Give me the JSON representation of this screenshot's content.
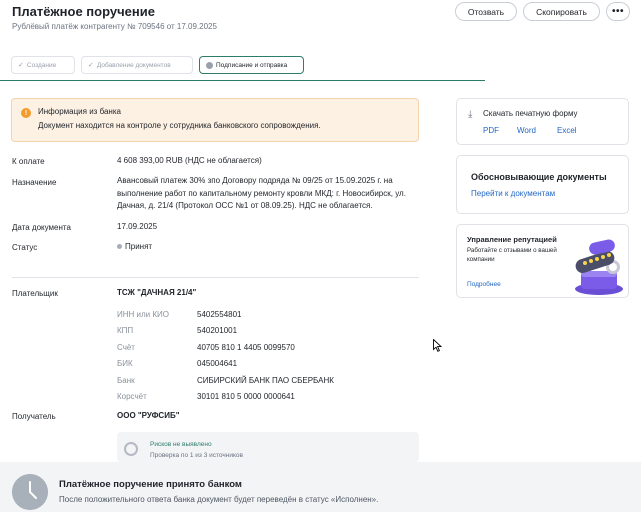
{
  "header": {
    "title": "Платёжное поручение",
    "subtitle": "Рублёвый платёж контрагенту № 709546 от 17.09.2025"
  },
  "actions": {
    "revoke_label": "Отозвать",
    "copy_label": "Скопировать",
    "more_label": "•••"
  },
  "steps": [
    {
      "label": "Создание",
      "state": "done"
    },
    {
      "label": "Добавление документов",
      "state": "done"
    },
    {
      "label": "Подписание и отправка",
      "state": "active"
    }
  ],
  "alert": {
    "title": "Информация из банка",
    "text": "Документ находится на контроле у сотрудника банковского сопровождения.",
    "icon": "warning-icon",
    "color": "#f59b2c"
  },
  "details": {
    "amount_label": "К оплате",
    "amount_value": "4 608 393,00 RUB (НДС не облагается)",
    "purpose_label": "Назначение",
    "purpose_value": "Авансовый платеж 30% зпо Договору подряда № 09/25 от 15.09.2025 г. на выполнение работ по капитальному ремонту кровли МКД: г. Новосибирск, ул. Дачная, д. 21/4 (Протокол ОСС №1 от 08.09.25). НДС не облагается.",
    "date_label": "Дата документа",
    "date_value": "17.09.2025",
    "status_label": "Статус",
    "status_value": "Принят"
  },
  "payer": {
    "label": "Плательщик",
    "name": "ТСЖ \"ДАЧНАЯ 21/4\"",
    "fields": [
      {
        "label": "ИНН или КИО",
        "value": "5402554801"
      },
      {
        "label": "КПП",
        "value": "540201001"
      },
      {
        "label": "Счёт",
        "value": "40705 810 1 4405 0099570"
      },
      {
        "label": "БИК",
        "value": "045004641"
      },
      {
        "label": "Банк",
        "value": "СИБИРСКИЙ БАНК ПАО СБЕРБАНК"
      },
      {
        "label": "Корсчёт",
        "value": "30101 810 5 0000 0000641"
      }
    ]
  },
  "recipient": {
    "label": "Получатель",
    "name": "ООО \"РУФСИБ\""
  },
  "risk": {
    "title": "Рисков не выявлено",
    "subtitle": "Проверка по 1 из 3 источников"
  },
  "sidebar": {
    "download": {
      "title": "Скачать печатную форму",
      "formats": [
        "PDF",
        "Word",
        "Excel"
      ]
    },
    "documents": {
      "title": "Обосновывающие документы",
      "link": "Перейти к документам"
    },
    "reputation": {
      "title": "Управление репутацией",
      "text": "Работайте с отзывами о вашей компании",
      "link": "Подробнее"
    }
  },
  "footer": {
    "title": "Платёжное поручение принято банком",
    "text": "После положительного ответа банка документ будет переведён в статус «Исполнен»."
  }
}
